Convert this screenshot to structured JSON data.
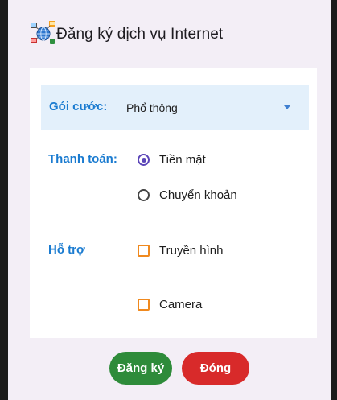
{
  "dialog": {
    "title": "Đăng ký dịch vụ Internet",
    "icon": "internet-service-icon"
  },
  "package": {
    "label": "Gói cước:",
    "selected": "Phổ thông"
  },
  "payment": {
    "label": "Thanh toán:",
    "options": [
      {
        "label": "Tiền mặt",
        "checked": true
      },
      {
        "label": "Chuyển khoản",
        "checked": false
      }
    ]
  },
  "support": {
    "label": "Hỗ trợ",
    "options": [
      {
        "label": "Truyền hình",
        "checked": false
      },
      {
        "label": "Camera",
        "checked": false
      }
    ]
  },
  "buttons": {
    "register": "Đăng ký",
    "close": "Đóng"
  },
  "colors": {
    "accent_blue": "#1a7bd0",
    "spinner_bg": "#e3f0fb",
    "radio_selected": "#5b45b8",
    "checkbox": "#f0891e",
    "register_green": "#2e8b3a",
    "close_red": "#d82a2a"
  }
}
